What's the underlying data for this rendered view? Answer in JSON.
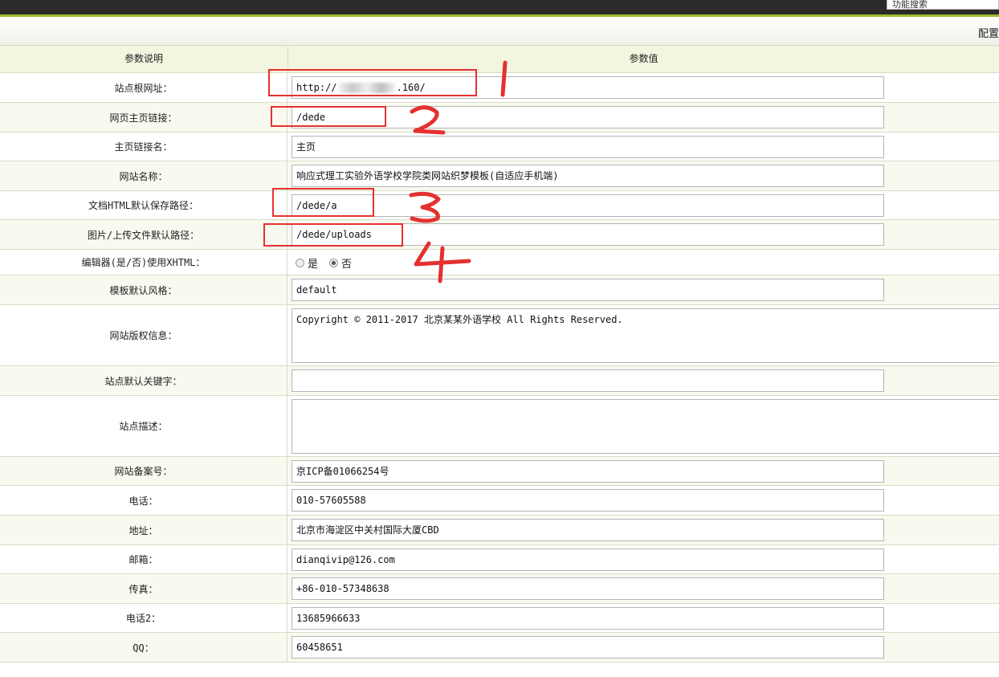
{
  "topbar": {
    "search_label": "功能搜索"
  },
  "config_title": "配置",
  "header": {
    "param_desc": "参数说明",
    "param_value": "参数值"
  },
  "rows": [
    {
      "label": "站点根网址：",
      "prefix": "http://",
      "suffix": ".160/"
    },
    {
      "label": "网页主页链接：",
      "value": "/dede"
    },
    {
      "label": "主页链接名：",
      "value": "主页"
    },
    {
      "label": "网站名称：",
      "value": "响应式理工实验外语学校学院类网站织梦模板(自适应手机端)"
    },
    {
      "label": "文档HTML默认保存路径：",
      "value": "/dede/a"
    },
    {
      "label": "图片/上传文件默认路径：",
      "value": "/dede/uploads"
    },
    {
      "label": "编辑器(是/否)使用XHTML：",
      "yes": "是",
      "no": "否",
      "selected": "否"
    },
    {
      "label": "模板默认风格：",
      "value": "default"
    },
    {
      "label": "网站版权信息：",
      "value": "Copyright © 2011-2017 北京某某外语学校 All Rights Reserved."
    },
    {
      "label": "站点默认关键字：",
      "value": ""
    },
    {
      "label": "站点描述：",
      "value": ""
    },
    {
      "label": "网站备案号：",
      "value": "京ICP备01066254号"
    },
    {
      "label": "电话：",
      "value": "010-57605588"
    },
    {
      "label": "地址：",
      "value": "北京市海淀区中关村国际大厦CBD"
    },
    {
      "label": "邮箱：",
      "value": "dianqivip@126.com"
    },
    {
      "label": "传真：",
      "value": "+86-010-57348638"
    },
    {
      "label": "电话2：",
      "value": "13685966633"
    },
    {
      "label": "QQ：",
      "value": "60458651"
    }
  ],
  "annotations": {
    "color": "#e53030",
    "numbers": [
      "1",
      "2",
      "3",
      "4"
    ]
  }
}
